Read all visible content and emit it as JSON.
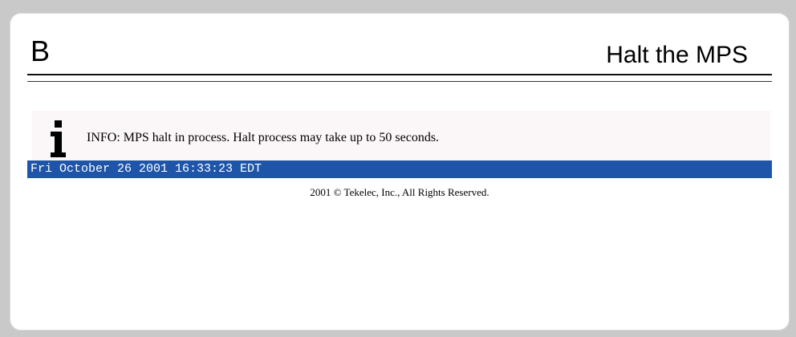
{
  "panel": {
    "letter": "B",
    "title": "Halt the MPS"
  },
  "info": {
    "icon": "info-icon",
    "message": "INFO: MPS halt in process. Halt process may take up to 50 seconds."
  },
  "status_bar": {
    "datetime": "Fri October 26 2001 16:33:23 EDT",
    "color": "#1f55a8"
  },
  "footer": {
    "copyright": "2001 © Tekelec, Inc., All Rights Reserved."
  }
}
